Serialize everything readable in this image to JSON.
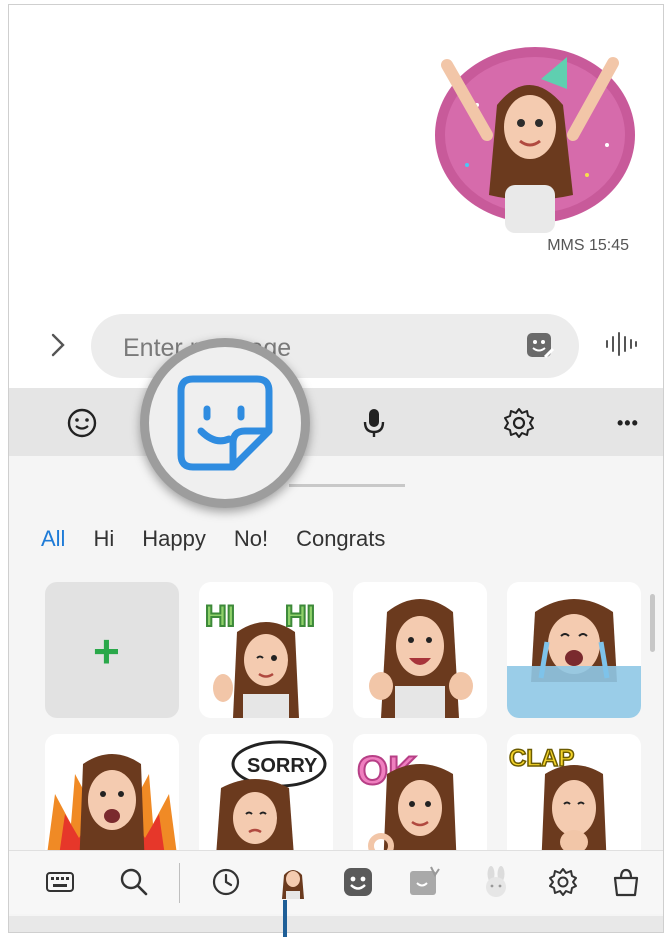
{
  "chat": {
    "message_meta": "MMS 15:45",
    "sticker_name": "party-donut-sticker"
  },
  "composer": {
    "placeholder": "Enter message",
    "expand_icon": "chevron-right-icon",
    "sticker_icon": "sticker-icon",
    "voice_icon": "voice-wave-icon"
  },
  "toolbar": {
    "items": [
      "emoji-icon",
      "sticker-icon",
      "microphone-icon",
      "settings-icon",
      "more-icon"
    ],
    "more_label": "•••"
  },
  "categories": {
    "items": [
      "All",
      "Hi",
      "Happy",
      "No!",
      "Congrats"
    ],
    "active": "All"
  },
  "stickers": {
    "add_label": "+",
    "row1": [
      "add",
      "hi-hi",
      "thumbs-up-laugh",
      "crying-pool"
    ],
    "row2": [
      "fire-angry",
      "sorry",
      "ok",
      "clap"
    ],
    "sticker_text": {
      "hi": "HI",
      "sorry": "SORRY",
      "ok": "OK",
      "clap": "CLAP"
    }
  },
  "bottombar": {
    "items": [
      "keyboard-icon",
      "search-icon",
      "recent-icon",
      "avatar-icon",
      "sticker-icon",
      "ar-emoji-icon",
      "bunny-icon",
      "settings-icon",
      "store-bag-icon"
    ]
  },
  "colors": {
    "accent": "#1e7bd7",
    "plus": "#2aa84a",
    "donut": "#d7559f",
    "hair": "#6b3a1e"
  }
}
